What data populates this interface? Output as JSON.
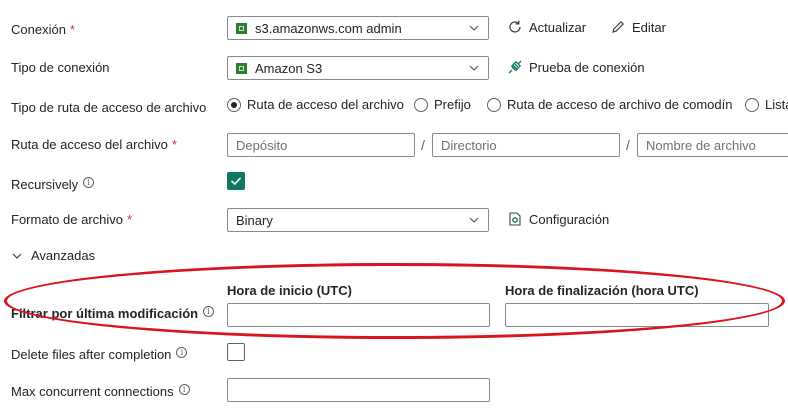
{
  "connection": {
    "label": "Conexión",
    "required_mark": "*",
    "value": "s3.amazonws.com admin",
    "refresh_label": "Actualizar",
    "edit_label": "Editar"
  },
  "connection_type": {
    "label": "Tipo de conexión",
    "value": "Amazon S3",
    "test_label": "Prueba de conexión"
  },
  "path_type": {
    "label": "Tipo de ruta de acceso de archivo",
    "options": [
      {
        "label": "Ruta de acceso del archivo",
        "selected": true
      },
      {
        "label": "Prefijo",
        "selected": false
      },
      {
        "label": "Ruta de acceso de archivo de comodín",
        "selected": false
      },
      {
        "label": "Lista",
        "selected": false
      }
    ]
  },
  "file_path": {
    "label": "Ruta de acceso del archivo",
    "required_mark": "*",
    "bucket_placeholder": "Depósito",
    "directory_placeholder": "Directorio",
    "filename_placeholder": "Nombre de archivo",
    "separator": "/"
  },
  "recursively": {
    "label": "Recursively",
    "info_icon": "i",
    "checked": true
  },
  "file_format": {
    "label": "Formato de archivo",
    "required_mark": "*",
    "value": "Binary",
    "settings_label": "Configuración"
  },
  "advanced": {
    "label": "Avanzadas"
  },
  "last_modified_filter": {
    "label": "Filtrar por última modificación",
    "info_icon": "i",
    "start_label": "Hora de inicio (UTC)",
    "end_label": "Hora de finalización (hora UTC)",
    "start_value": "",
    "end_value": ""
  },
  "delete_after": {
    "label": "Delete files after completion",
    "info_icon": "i",
    "checked": false
  },
  "max_connections": {
    "label": "Max concurrent connections",
    "info_icon": "i",
    "value": ""
  },
  "colors": {
    "accent_green": "#117865",
    "highlight_red": "#d8141e",
    "required_red": "#c4314b"
  }
}
